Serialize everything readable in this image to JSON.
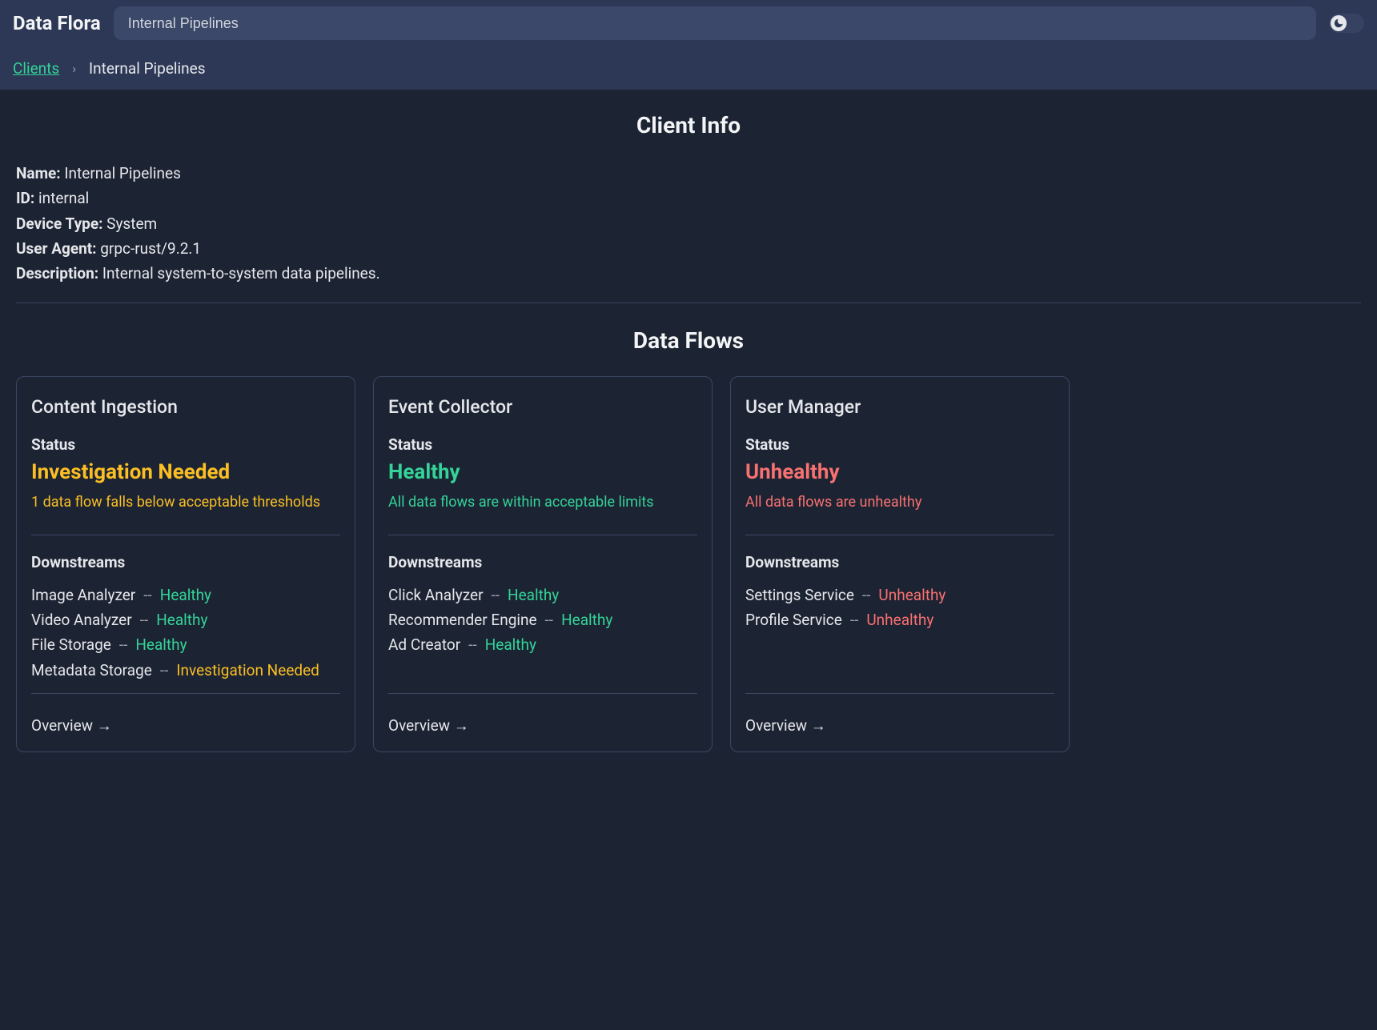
{
  "app": {
    "title": "Data Flora"
  },
  "search": {
    "value": "Internal Pipelines"
  },
  "colors": {
    "warn": "#fbbf24",
    "ok": "#34d399",
    "bad": "#f87171",
    "link": "#34d399"
  },
  "breadcrumb": {
    "root": "Clients",
    "sep": "›",
    "current": "Internal Pipelines"
  },
  "clientInfo": {
    "heading": "Client Info",
    "labels": {
      "name": "Name:",
      "id": "ID:",
      "deviceType": "Device Type:",
      "userAgent": "User Agent:",
      "description": "Description:"
    },
    "values": {
      "name": "Internal Pipelines",
      "id": "internal",
      "deviceType": "System",
      "userAgent": "grpc-rust/9.2.1",
      "description": "Internal system-to-system data pipelines."
    }
  },
  "dataFlows": {
    "heading": "Data Flows",
    "statusLabel": "Status",
    "downstreamsLabel": "Downstreams",
    "overviewLabel": "Overview →",
    "dsSep": "--",
    "cards": [
      {
        "title": "Content Ingestion",
        "statusValue": "Investigation Needed",
        "statusClass": "c-warn",
        "statusNote": "1 data flow falls below acceptable thresholds",
        "downstreams": [
          {
            "name": "Image Analyzer",
            "status": "Healthy",
            "class": "c-ok"
          },
          {
            "name": "Video Analyzer",
            "status": "Healthy",
            "class": "c-ok"
          },
          {
            "name": "File Storage",
            "status": "Healthy",
            "class": "c-ok"
          },
          {
            "name": "Metadata Storage",
            "status": "Investigation Needed",
            "class": "c-warn"
          }
        ]
      },
      {
        "title": "Event Collector",
        "statusValue": "Healthy",
        "statusClass": "c-ok",
        "statusNote": "All data flows are within acceptable limits",
        "downstreams": [
          {
            "name": "Click Analyzer",
            "status": "Healthy",
            "class": "c-ok"
          },
          {
            "name": "Recommender Engine",
            "status": "Healthy",
            "class": "c-ok"
          },
          {
            "name": "Ad Creator",
            "status": "Healthy",
            "class": "c-ok"
          }
        ]
      },
      {
        "title": "User Manager",
        "statusValue": "Unhealthy",
        "statusClass": "c-bad",
        "statusNote": "All data flows are unhealthy",
        "downstreams": [
          {
            "name": "Settings Service",
            "status": "Unhealthy",
            "class": "c-bad"
          },
          {
            "name": "Profile Service",
            "status": "Unhealthy",
            "class": "c-bad"
          }
        ]
      }
    ]
  }
}
